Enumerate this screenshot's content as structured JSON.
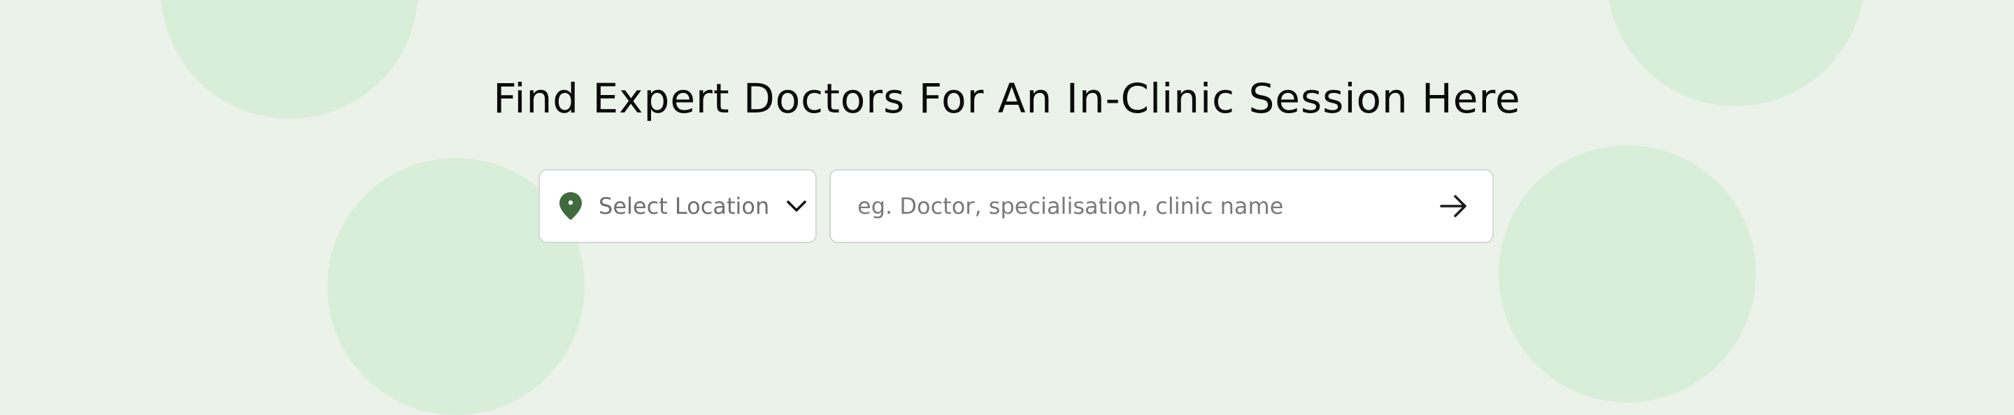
{
  "hero": {
    "headline": "Find Expert Doctors For An In-Clinic Session Here"
  },
  "location": {
    "label": "Select Location",
    "icon": "map-pin-icon",
    "dropdown_icon": "chevron-down-icon"
  },
  "search": {
    "placeholder": "eg. Doctor, specialisation, clinic name",
    "value": "",
    "submit_icon": "arrow-right-icon"
  },
  "colors": {
    "background": "#ebf2ea",
    "decorative_circle": "#d9eed9",
    "pin": "#3f6b3e",
    "text": "#0b0b0b"
  }
}
